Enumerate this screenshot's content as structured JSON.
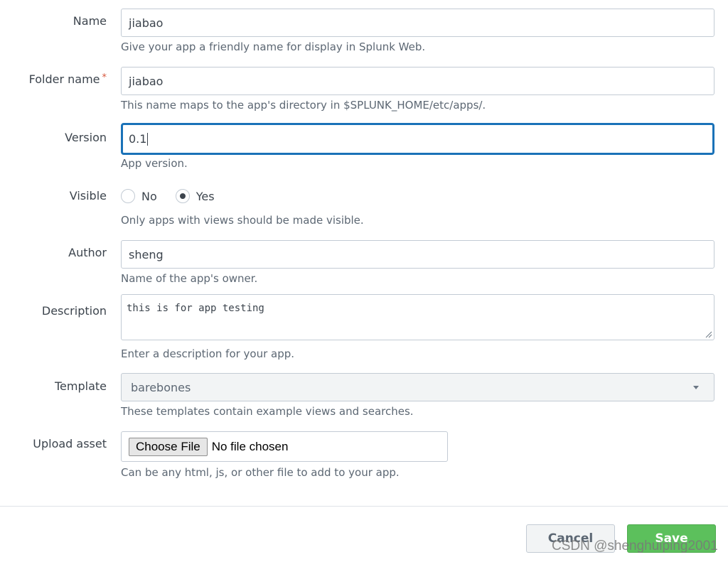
{
  "form": {
    "name": {
      "label": "Name",
      "value": "jiabao",
      "help": "Give your app a friendly name for display in Splunk Web."
    },
    "folder_name": {
      "label": "Folder name",
      "required_mark": "*",
      "value": "jiabao",
      "help": "This name maps to the app's directory in $SPLUNK_HOME/etc/apps/."
    },
    "version": {
      "label": "Version",
      "value": "0.1",
      "help": "App version."
    },
    "visible": {
      "label": "Visible",
      "options": [
        "No",
        "Yes"
      ],
      "selected": "Yes",
      "help": "Only apps with views should be made visible."
    },
    "author": {
      "label": "Author",
      "value": "sheng",
      "help": "Name of the app's owner."
    },
    "description": {
      "label": "Description",
      "value": "this is for app testing",
      "help": "Enter a description for your app."
    },
    "template": {
      "label": "Template",
      "value": "barebones",
      "help": "These templates contain example views and searches."
    },
    "upload_asset": {
      "label": "Upload asset",
      "button_label": "Choose File",
      "status": "No file chosen",
      "help": "Can be any html, js, or other file to add to your app."
    }
  },
  "footer": {
    "cancel_label": "Cancel",
    "save_label": "Save"
  },
  "watermark": "CSDN @shenghuiping2001",
  "colors": {
    "focus_border": "#1a72b8",
    "save_button": "#5cc05c",
    "required": "#d6563c"
  }
}
